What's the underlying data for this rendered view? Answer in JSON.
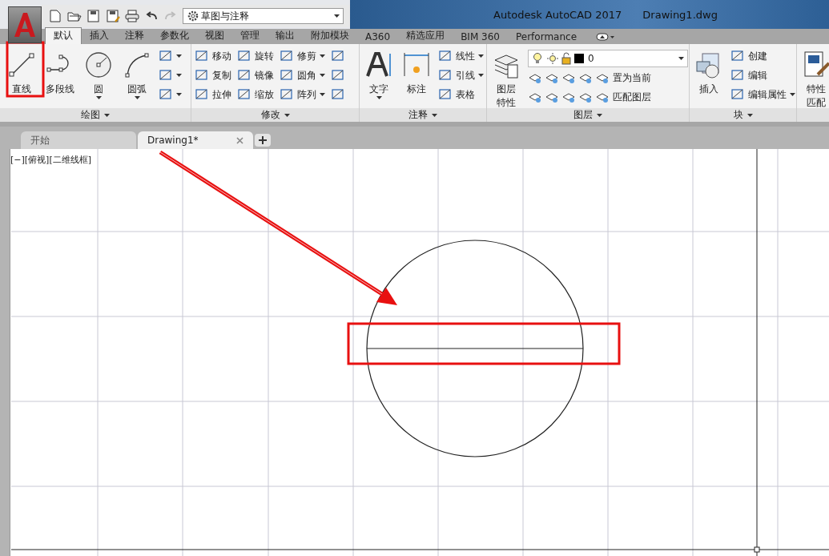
{
  "title_bar": {
    "app": "Autodesk AutoCAD 2017",
    "file": "Drawing1.dwg",
    "workspace": "草图与注释"
  },
  "ribbon_tabs": [
    {
      "label": "默认",
      "selected": true
    },
    {
      "label": "插入",
      "selected": false
    },
    {
      "label": "注释",
      "selected": false
    },
    {
      "label": "参数化",
      "selected": false
    },
    {
      "label": "视图",
      "selected": false
    },
    {
      "label": "管理",
      "selected": false
    },
    {
      "label": "输出",
      "selected": false
    },
    {
      "label": "附加模块",
      "selected": false
    },
    {
      "label": "A360",
      "selected": false
    },
    {
      "label": "精选应用",
      "selected": false
    },
    {
      "label": "BIM 360",
      "selected": false
    },
    {
      "label": "Performance",
      "selected": false
    }
  ],
  "panels": [
    {
      "title": "绘图",
      "columns": [
        [
          {
            "kind": "large",
            "label": "直线",
            "dropdown": false
          }
        ],
        [
          {
            "kind": "large",
            "label": "多段线",
            "dropdown": false
          }
        ],
        [
          {
            "kind": "large",
            "label": "圆",
            "dropdown": true
          }
        ],
        [
          {
            "kind": "large",
            "label": "圆弧",
            "dropdown": true
          }
        ],
        [
          {
            "kind": "icon",
            "dropdown": true
          },
          {
            "kind": "icon",
            "dropdown": true
          },
          {
            "kind": "icon",
            "dropdown": true
          }
        ]
      ]
    },
    {
      "title": "修改",
      "columns": [
        [
          {
            "kind": "small",
            "label": "移动",
            "dropdown": false
          },
          {
            "kind": "small",
            "label": "复制",
            "dropdown": false
          },
          {
            "kind": "small",
            "label": "拉伸",
            "dropdown": false
          }
        ],
        [
          {
            "kind": "small",
            "label": "旋转",
            "dropdown": false
          },
          {
            "kind": "small",
            "label": "镜像",
            "dropdown": false
          },
          {
            "kind": "small",
            "label": "缩放",
            "dropdown": false
          }
        ],
        [
          {
            "kind": "small",
            "label": "修剪",
            "dropdown": true
          },
          {
            "kind": "small",
            "label": "圆角",
            "dropdown": true
          },
          {
            "kind": "small",
            "label": "阵列",
            "dropdown": true
          }
        ],
        [
          {
            "kind": "icon",
            "dropdown": false
          },
          {
            "kind": "icon",
            "dropdown": false
          },
          {
            "kind": "icon",
            "dropdown": false
          }
        ]
      ]
    },
    {
      "title": "注释",
      "columns": [
        [
          {
            "kind": "large",
            "label": "文字",
            "dropdown": true
          }
        ],
        [
          {
            "kind": "large",
            "label": "标注",
            "dropdown": false
          }
        ],
        [
          {
            "kind": "small",
            "label": "线性",
            "dropdown": true
          },
          {
            "kind": "small",
            "label": "引线",
            "dropdown": true
          },
          {
            "kind": "small",
            "label": "表格",
            "dropdown": false
          }
        ]
      ]
    },
    {
      "title": "图层",
      "columns": [
        [
          {
            "kind": "tall",
            "label": "图层特性",
            "dropdown": false
          }
        ],
        [
          {
            "kind": "combo",
            "value": "0"
          },
          {
            "kind": "row",
            "items": [
              {
                "kind": "icon",
                "dropdown": false
              },
              {
                "kind": "icon",
                "dropdown": false
              },
              {
                "kind": "icon",
                "dropdown": false
              },
              {
                "kind": "icon",
                "dropdown": false
              },
              {
                "kind": "small",
                "label": "置为当前",
                "dropdown": false
              }
            ]
          },
          {
            "kind": "row",
            "items": [
              {
                "kind": "icon",
                "dropdown": false
              },
              {
                "kind": "icon",
                "dropdown": false
              },
              {
                "kind": "icon",
                "dropdown": false
              },
              {
                "kind": "icon",
                "dropdown": false
              },
              {
                "kind": "small",
                "label": "匹配图层",
                "dropdown": false
              }
            ]
          }
        ]
      ]
    },
    {
      "title": "块",
      "columns": [
        [
          {
            "kind": "large",
            "label": "插入",
            "dropdown": false
          }
        ],
        [
          {
            "kind": "small",
            "label": "创建",
            "dropdown": false
          },
          {
            "kind": "small",
            "label": "编辑",
            "dropdown": false
          },
          {
            "kind": "small",
            "label": "编辑属性",
            "dropdown": true
          }
        ]
      ]
    },
    {
      "columns": [
        [
          {
            "kind": "tall",
            "label": "特性匹配",
            "dropdown": false
          }
        ]
      ]
    }
  ],
  "document_tabs": [
    {
      "label": "开始",
      "selected": false,
      "closable": false
    },
    {
      "label": "Drawing1*",
      "selected": true,
      "closable": true
    }
  ],
  "viewport_label": "[−][俯视][二维线框]"
}
